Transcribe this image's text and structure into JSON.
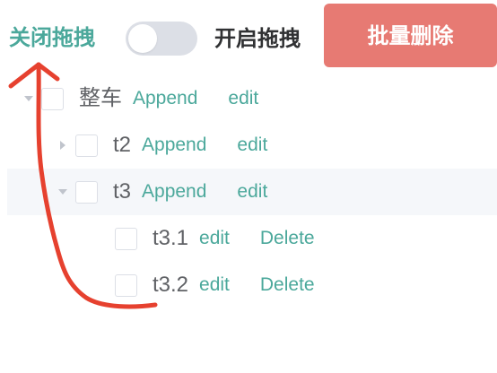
{
  "toolbar": {
    "close_drag_label": "关闭拖拽",
    "open_drag_label": "开启拖拽",
    "batch_delete_label": "批量删除",
    "toggle_state": "off"
  },
  "tree": {
    "nodes": [
      {
        "label": "整车",
        "expanded": true,
        "actions": [
          "Append",
          "edit"
        ]
      },
      {
        "label": "t2",
        "expanded": false,
        "actions": [
          "Append",
          "edit"
        ]
      },
      {
        "label": "t3",
        "expanded": true,
        "actions": [
          "Append",
          "edit"
        ]
      },
      {
        "label": "t3.1",
        "leaf": true,
        "actions": [
          "edit",
          "Delete"
        ]
      },
      {
        "label": "t3.2",
        "leaf": true,
        "actions": [
          "edit",
          "Delete"
        ]
      }
    ]
  },
  "colors": {
    "accent": "#4ba89b",
    "danger_button": "#e77a73",
    "annotation": "#e6412f",
    "text": "#606266",
    "toggle_off": "#dcdfe6",
    "row_highlight": "#f5f7fa"
  },
  "icons": {
    "expanded": "caret-down-icon",
    "collapsed": "caret-right-icon"
  }
}
